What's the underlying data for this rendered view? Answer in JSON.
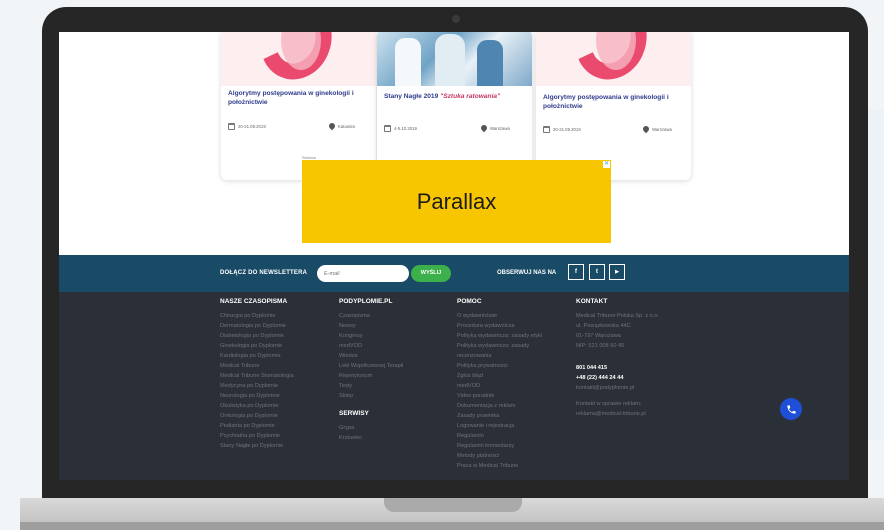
{
  "cards": [
    {
      "title": "Algorytmy postępowania w ginekologii i położnictwie",
      "title_em": "",
      "date": "20-21.09.2019",
      "location": "Katowice"
    },
    {
      "title": "Stany Nagłe 2019 ",
      "title_em": "\"Sztuka ratowania\"",
      "date": "4-5.10.2019",
      "location": "Warszawa"
    },
    {
      "title": "Algorytmy postępowania w ginekologii i położnictwie",
      "title_em": "",
      "date": "20-21.09.2019",
      "location": "Warszawa"
    }
  ],
  "ad": {
    "label": "Reklama",
    "text": "Parallax",
    "close": "✕"
  },
  "newsletter": {
    "label": "DOŁĄCZ DO NEWSLETTERA",
    "placeholder": "E-mail",
    "send": "WYŚLIJ",
    "follow": "OBSERWUJ NAS NA"
  },
  "social": {
    "facebook": "f",
    "twitter": "t",
    "youtube": "▶"
  },
  "footer": {
    "magazines": {
      "heading": "NASZE CZASOPISMA",
      "items": [
        "Chirurgia po Dyplomie",
        "Dermatologia po Dyplomie",
        "Diabetologia po Dyplomie",
        "Ginekologia po Dyplomie",
        "Kardiologia po Dyplomie",
        "Medical Tribune",
        "Medical Tribune Stomatologia",
        "Medycyna po Dyplomie",
        "Neurologia po Dyplomie",
        "Okulistyka po Dyplomie",
        "Onkologia po Dyplomie",
        "Pediatria po Dyplomie",
        "Psychiatria po Dyplomie",
        "Stany Nagłe po Dyplomie"
      ]
    },
    "podyplomie": {
      "heading": "PODYPLOMIE.PL",
      "items": [
        "Czasopisma",
        "Newsy",
        "Kongresy",
        "medVOD",
        "Wiedza",
        "Leki Współczesnej Terapii",
        "Repetytorium",
        "Testy",
        "Sklep"
      ]
    },
    "services": {
      "heading": "SERWISY",
      "items": [
        "Grypa",
        "Krztusiec"
      ]
    },
    "help": {
      "heading": "POMOC",
      "items": [
        "O wydawnictwie",
        "Procedura wydawnicza",
        "Polityka wydawnicza: zasady etyki",
        "Polityka wydawnicza: zasady",
        "recenzowania",
        "Polityka prywatności",
        "Zgłoś błąd",
        "medVOD",
        "Video poradnik",
        "Dokumentacja z reklam",
        "Zasady prawnika",
        "Logowanie i rejestracja",
        "Regulamin",
        "Regulamin komentarzy",
        "Metody płatności",
        "Praca w Medical Tribune"
      ]
    },
    "contact": {
      "heading": "KONTAKT",
      "address": [
        "Medical Tribune Polska Sp. z o.o.",
        "ul. Powązkowska 44C",
        "01-797 Warszawa",
        "NIP: 521 008 60 45"
      ],
      "phone1": "801 044 415",
      "phone2": "+48 (22) 444 24 44",
      "email": "kontakt@podyplomie.pl",
      "ads_label": "Kontakt w sprawie reklam:",
      "ads_email": "reklama@medical-tribune.pl"
    }
  },
  "colors": {
    "navy": "#194b66",
    "footer_bg": "#2b2f37",
    "green": "#3cb04a",
    "ad_yellow": "#f7c600",
    "phone_blue": "#1e4fd6"
  }
}
